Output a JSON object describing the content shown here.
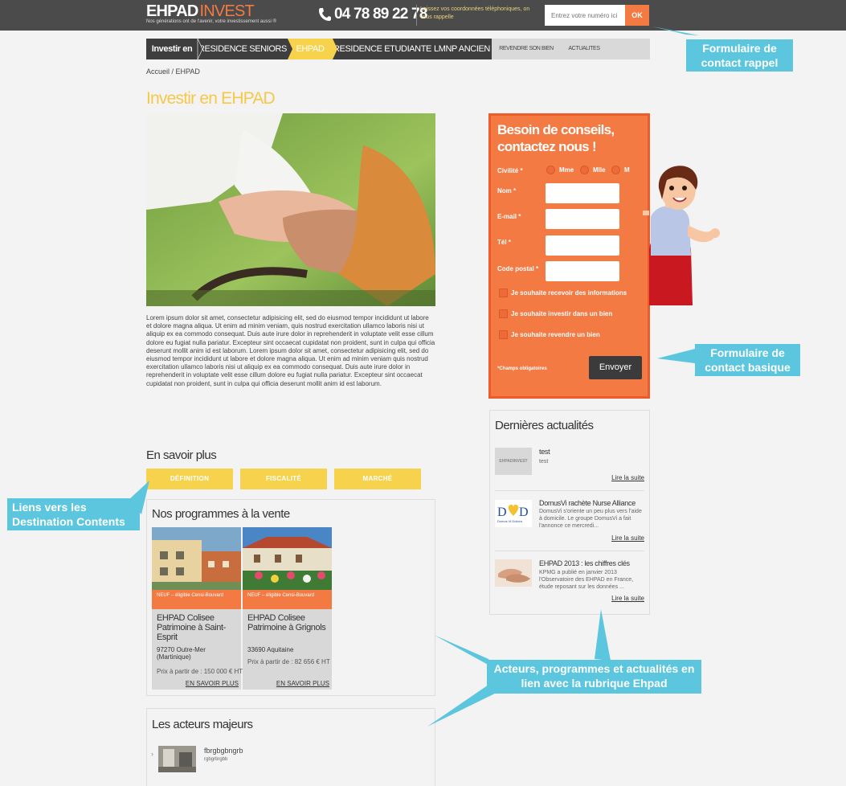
{
  "header": {
    "logo_main": "EHPAD",
    "logo_accent": "INVEST",
    "tagline": "Nos générations ont de l'avenir, votre investissement aussi ®",
    "phone": "04 78 89 22 78",
    "phone_note": "Laissez vos coordonnées téléphoniques, on vous rappelle",
    "callback_placeholder": "Entrez votre numéro ici",
    "callback_button": "OK"
  },
  "nav": {
    "items": [
      {
        "label": "Investir en"
      },
      {
        "label": "RESIDENCE SENIORS"
      },
      {
        "label": "EHPAD"
      },
      {
        "label": "RESIDENCE ETUDIANTE"
      },
      {
        "label": "LMNP ANCIEN"
      },
      {
        "label": "REVENDRE SON BIEN"
      },
      {
        "label": "ACTUALITES"
      }
    ]
  },
  "breadcrumb": "Accueil / EHPAD",
  "page_title": "Investir en EHPAD",
  "body_text": "Lorem ipsum dolor sit amet, consectetur adipisicing elit, sed do eiusmod tempor incididunt ut labore et dolore magna aliqua. Ut enim ad minim veniam, quis nostrud exercitation ullamco laboris nisi ut aliquip ex ea commodo consequat. Duis aute irure dolor in reprehenderit in voluptate velit esse cillum dolore eu fugiat nulla pariatur. Excepteur sint occaecat cupidatat non proident, sunt in culpa qui officia deserunt mollit anim id est laborum. Lorem ipsum dolor sit amet, consectetur adipisicing elit, sed do eiusmod tempor incididunt ut labore et dolore magna aliqua. Ut enim ad minim veniam quis nostrud exercitation ullamco laboris nisi ut aliquip ex ea commodo consequat. Duis aute irure dolor in reprehenderit in voluptate velit esse cillum dolore eu fugiat nulla pariatur. Excepteur sint occaecat cupidatat non proident, sunt in culpa qui officia deserunt mollit anim id est laborum.",
  "savoir_plus": {
    "title": "En savoir plus",
    "links": [
      "DÉFINITION",
      "FISCALITÉ",
      "MARCHÉ"
    ]
  },
  "programs": {
    "title": "Nos programmes à la vente",
    "items": [
      {
        "tag": "NEUF – éligible Censi-Bouvard",
        "name": "EHPAD Colisee Patrimoine à Saint-Esprit",
        "location": "97270 Outre-Mer (Martinique)",
        "price": "Prix à partir de : 150 000 € HT",
        "more": "EN SAVOIR PLUS"
      },
      {
        "tag": "NEUF – éligible Censi-Bouvard",
        "name": "EHPAD Colisee Patrimoine à Grignols",
        "location": "33690 Aquitaine",
        "price": "Prix à partir de : 82 656 € HT",
        "more": "EN SAVOIR PLUS"
      }
    ]
  },
  "actors": {
    "title": "Les acteurs majeurs",
    "items": [
      {
        "name": "fbrgbgbngrb",
        "sub": "rgbgrbrgbb"
      }
    ]
  },
  "contact_form": {
    "title": "Besoin de conseils, contactez nous !",
    "civilite_label": "Civilité *",
    "civilite_options": [
      "Mme",
      "Mlle",
      "M"
    ],
    "nom_label": "Nom *",
    "email_label": "E-mail *",
    "tel_label": "Tél *",
    "postal_label": "Code postal *",
    "checkboxes": [
      "Je souhaite recevoir des informations",
      "Je souhaite investir dans un bien",
      "Je souhaite revendre un bien"
    ],
    "required_note": "*Champs obligatoires",
    "submit": "Envoyer"
  },
  "news": {
    "title": "Dernières actualités",
    "items": [
      {
        "title": "test",
        "text": "test",
        "more": "Lire la suite",
        "thumb_text": "EHPADINVEST"
      },
      {
        "title": "DomusVi rachète Nurse Alliance",
        "text": "DomusVi s'oriente un peu plus vers l'aide à domicile. Le groupe DomusVi a fait l'annonce ce mercredi...",
        "more": "Lire la suite",
        "thumb_text": "Domus Vi Dolcéa"
      },
      {
        "title": "EHPAD 2013 : les chiffres clés",
        "text": "KPMG a publié en janvier 2013 l'Observatoire des EHPAD en France, étude reposant sur les données ...",
        "more": "Lire la suite",
        "thumb_text": ""
      }
    ]
  },
  "annotations": [
    "Formulaire de contact rappel",
    "Formulaire de contact basique",
    "Liens vers les Destination Contents",
    "Acteurs, programmes et actualités en lien avec la rubrique Ehpad"
  ],
  "colors": {
    "accent_orange": "#f47a44",
    "accent_yellow": "#f6d24d",
    "header_dark": "#4b4b4b",
    "callout_blue": "#5bc6de"
  }
}
